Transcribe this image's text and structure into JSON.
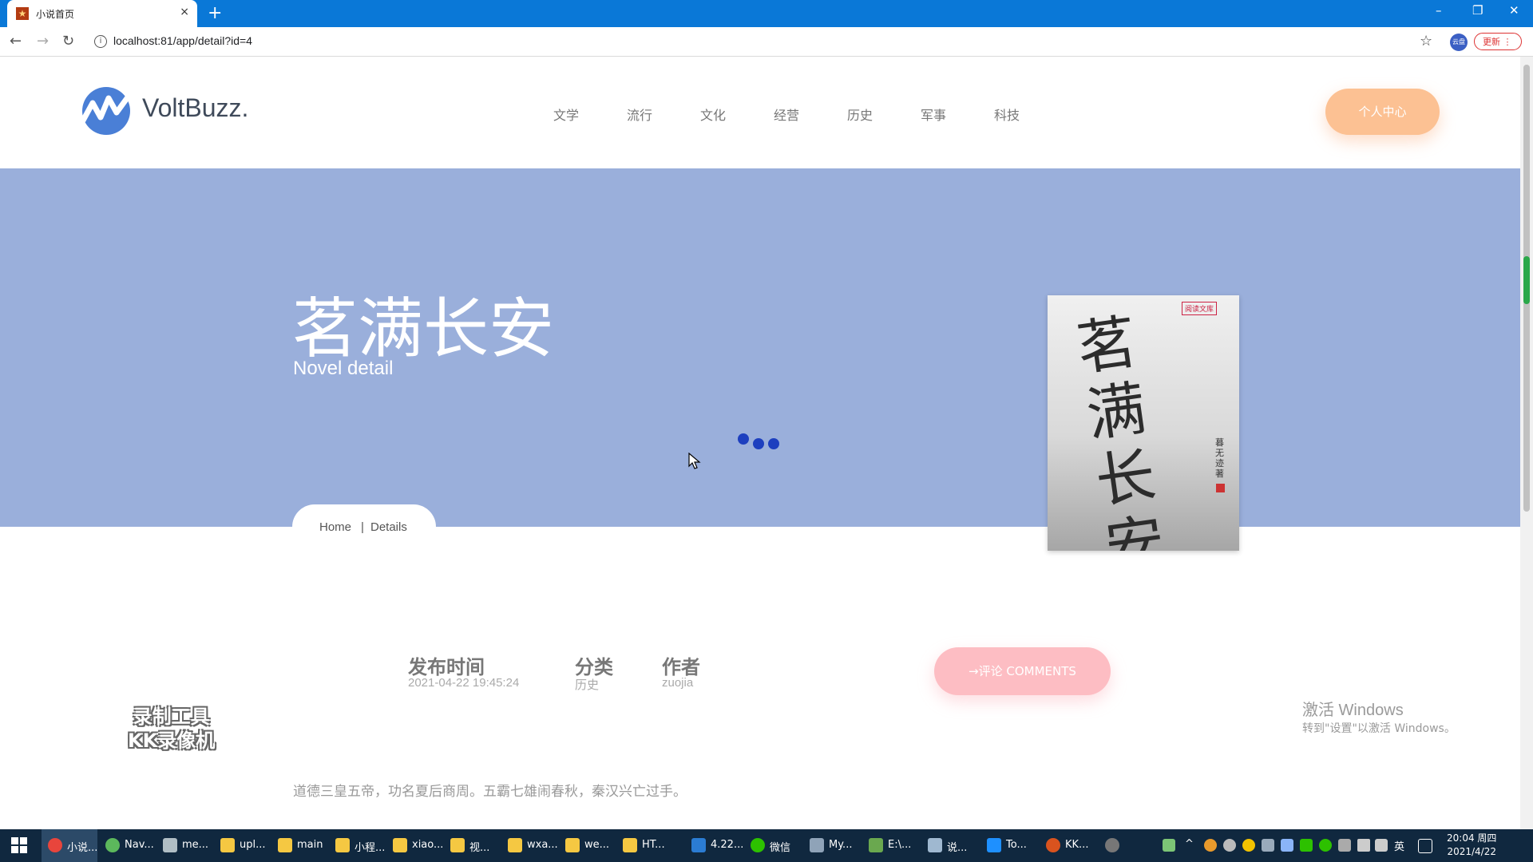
{
  "browser": {
    "tab_title": "小说首页",
    "tab_close": "×",
    "new_tab": "+",
    "url": "localhost:81/app/detail?id=4",
    "profile_badge": "云盘",
    "update_button": "更新 ⋮",
    "window_controls": {
      "minimize": "–",
      "restore": "❐",
      "close": "✕"
    }
  },
  "site": {
    "logo_text": "VoltBuzz.",
    "nav": [
      "文学",
      "流行",
      "文化",
      "经营",
      "历史",
      "军事",
      "科技"
    ],
    "personal_center": "个人中心"
  },
  "hero": {
    "title": "茗满长安",
    "subtitle": "Novel detail",
    "breadcrumb": {
      "home": "Home",
      "separator": "|",
      "current": "Details"
    }
  },
  "cover": {
    "calligraphy": "茗满长安",
    "stamp": "阅读文库",
    "author_vertical": "暮无迹著"
  },
  "meta": {
    "publish_label": "发布时间",
    "publish_value": "2021-04-22 19:45:24",
    "category_label": "分类",
    "category_value": "历史",
    "author_label": "作者",
    "author_value": "zuojia"
  },
  "comments_button": "→评论 COMMENTS",
  "intro_text": "道德三皇五帝，功名夏后商周。五霸七雄闹春秋，秦汉兴亡过手。",
  "overlays": {
    "recorder_line1": "录制工具",
    "recorder_line2": "KK录像机",
    "activate_title": "激活 Windows",
    "activate_sub": "转到\"设置\"以激活 Windows。"
  },
  "taskbar": {
    "items": [
      "小说...",
      "Nav...",
      "me...",
      "upl...",
      "main",
      "小程...",
      "xiao...",
      "视...",
      "wxa...",
      "we...",
      "HT...",
      "4.22...",
      "微信",
      "My...",
      "E:\\...",
      "说...",
      "To...",
      "KK..."
    ],
    "tray_ime": "英",
    "clock_time": "20:04 周四",
    "clock_date": "2021/4/22"
  },
  "colors": {
    "hero_bg": "#9aafdb",
    "accent_orange": "#fcc193",
    "accent_pink": "#fdbdc3",
    "loader_blue": "#1d3fbf",
    "titlebar_blue": "#0a78d7"
  }
}
